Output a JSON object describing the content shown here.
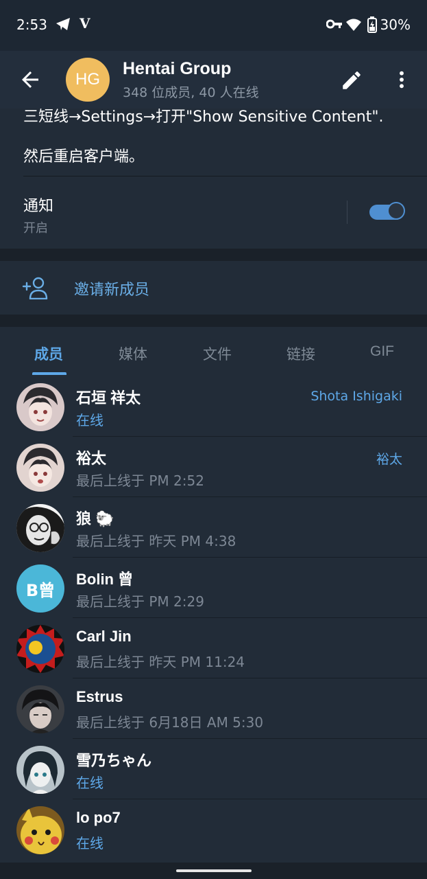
{
  "status_bar": {
    "time": "2:53",
    "battery": "30%",
    "app_icon_letter": "V"
  },
  "header": {
    "avatar_initials": "HG",
    "title": "Hentai Group",
    "subtitle": "348 位成员, 40 人在线"
  },
  "info": {
    "line1": "三短线→Settings→打开\"Show Sensitive Content\".",
    "line2": "然后重启客户端。",
    "notifications_label": "通知",
    "notifications_value": "开启",
    "notifications_on": true
  },
  "invite": {
    "label": "邀请新成员"
  },
  "tabs": [
    {
      "label": "成员",
      "active": true
    },
    {
      "label": "媒体"
    },
    {
      "label": "文件"
    },
    {
      "label": "链接"
    },
    {
      "label": "GIF"
    }
  ],
  "members": [
    {
      "name": "石垣 祥太",
      "status": "在线",
      "online": true,
      "role": "Shota Ishigaki"
    },
    {
      "name": "裕太",
      "status": "最后上线于 PM 2:52",
      "online": false,
      "role": "裕太"
    },
    {
      "name": "狼 🐑",
      "status": "最后上线于 昨天 PM 4:38",
      "online": false
    },
    {
      "name": "Bolin 曾",
      "status": "最后上线于 PM 2:29",
      "online": false,
      "avatar_initials": "B曾"
    },
    {
      "name": "Carl Jin",
      "status": "最后上线于 昨天 PM 11:24",
      "online": false
    },
    {
      "name": "Estrus",
      "status": "最后上线于 6月18日 AM 5:30",
      "online": false
    },
    {
      "name": "雪乃ちゃん",
      "status": "在线",
      "online": true
    },
    {
      "name": "lo po7",
      "status": "在线",
      "online": true
    }
  ],
  "colors": {
    "accent": "#5ea8e8",
    "group_avatar": "#f0bd5f",
    "bolin_avatar": "#4bb7d8"
  }
}
